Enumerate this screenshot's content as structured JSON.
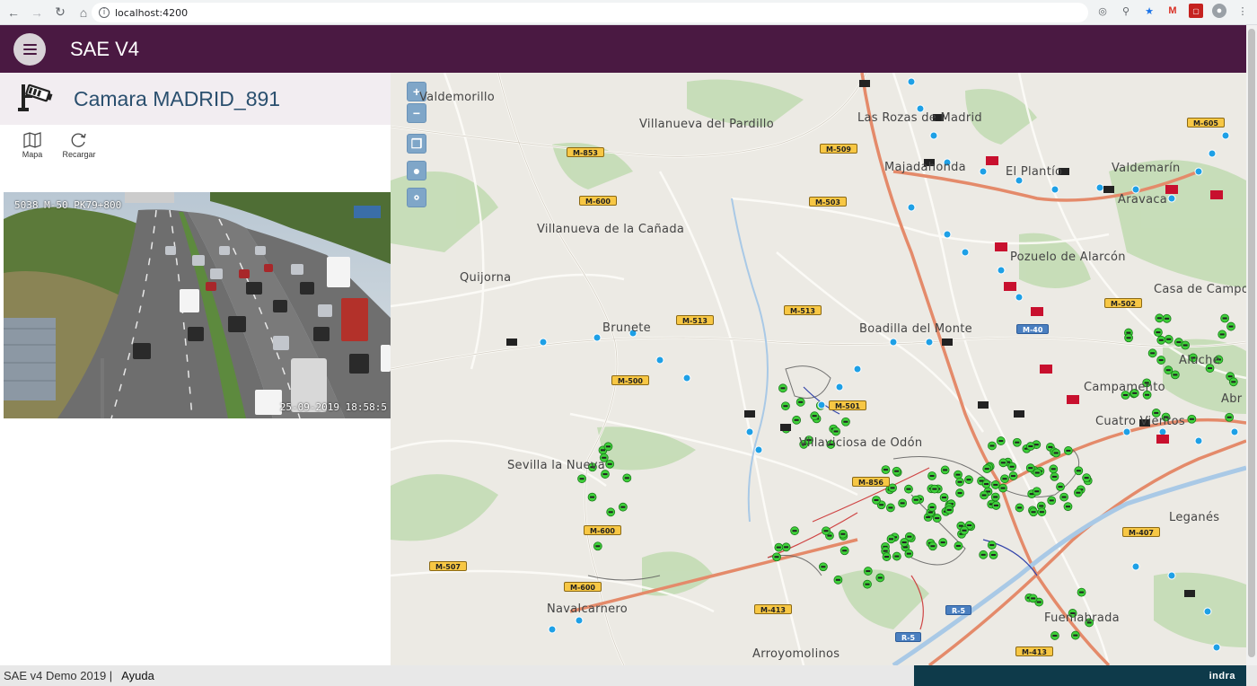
{
  "browser": {
    "url": "localhost:4200",
    "nav_icons": [
      "back-icon",
      "forward-icon",
      "reload-icon",
      "home-icon"
    ]
  },
  "header": {
    "title": "SAE V4",
    "menu_icon": "hamburger-icon"
  },
  "camera": {
    "title": "Camara MADRID_891",
    "icon": "cctv-camera-icon",
    "overlay_top": "5038 M-50 PK79+800",
    "overlay_bottom": "25-09-2019 18:58:5",
    "tools": [
      {
        "label": "Mapa",
        "icon": "map-icon"
      },
      {
        "label": "Recargar",
        "icon": "refresh-icon"
      }
    ]
  },
  "map": {
    "controls": [
      "+",
      "−",
      "layers-icon",
      "marker-icon",
      "cookie-icon"
    ],
    "places": [
      "Valdemorillo",
      "Villanueva del Pardillo",
      "Las Rozas de Madrid",
      "Majadahonda",
      "El Plantío",
      "Valdemarín",
      "Aravaca",
      "Villanueva de la Cañada",
      "Quijorna",
      "Pozuelo de Alarcón",
      "Casa de Campo",
      "Brunete",
      "Boadilla del Monte",
      "Aluche",
      "Campamento",
      "Cuatro Vientos",
      "Villaviciosa de Odón",
      "Sevilla la Nueva",
      "Leganés",
      "Navalcarnero",
      "Fuenlabrada",
      "Arroyomolinos",
      "Abr"
    ],
    "roads": [
      "M-853",
      "M-509",
      "M-600",
      "M-503",
      "M-513",
      "M-513",
      "M-600",
      "M-500",
      "M-856",
      "M-600",
      "M-507",
      "M-413",
      "M-413",
      "M-407",
      "M-502",
      "M-605",
      "R-5",
      "R-5",
      "M-40",
      "M-501"
    ]
  },
  "footer": {
    "version": "SAE v4 Demo 2019 |",
    "help": "Ayuda",
    "brand": "indra"
  },
  "colors": {
    "header": "#4a1942",
    "brand_bar": "#0e3a4a",
    "map_bg": "#eceae4"
  }
}
